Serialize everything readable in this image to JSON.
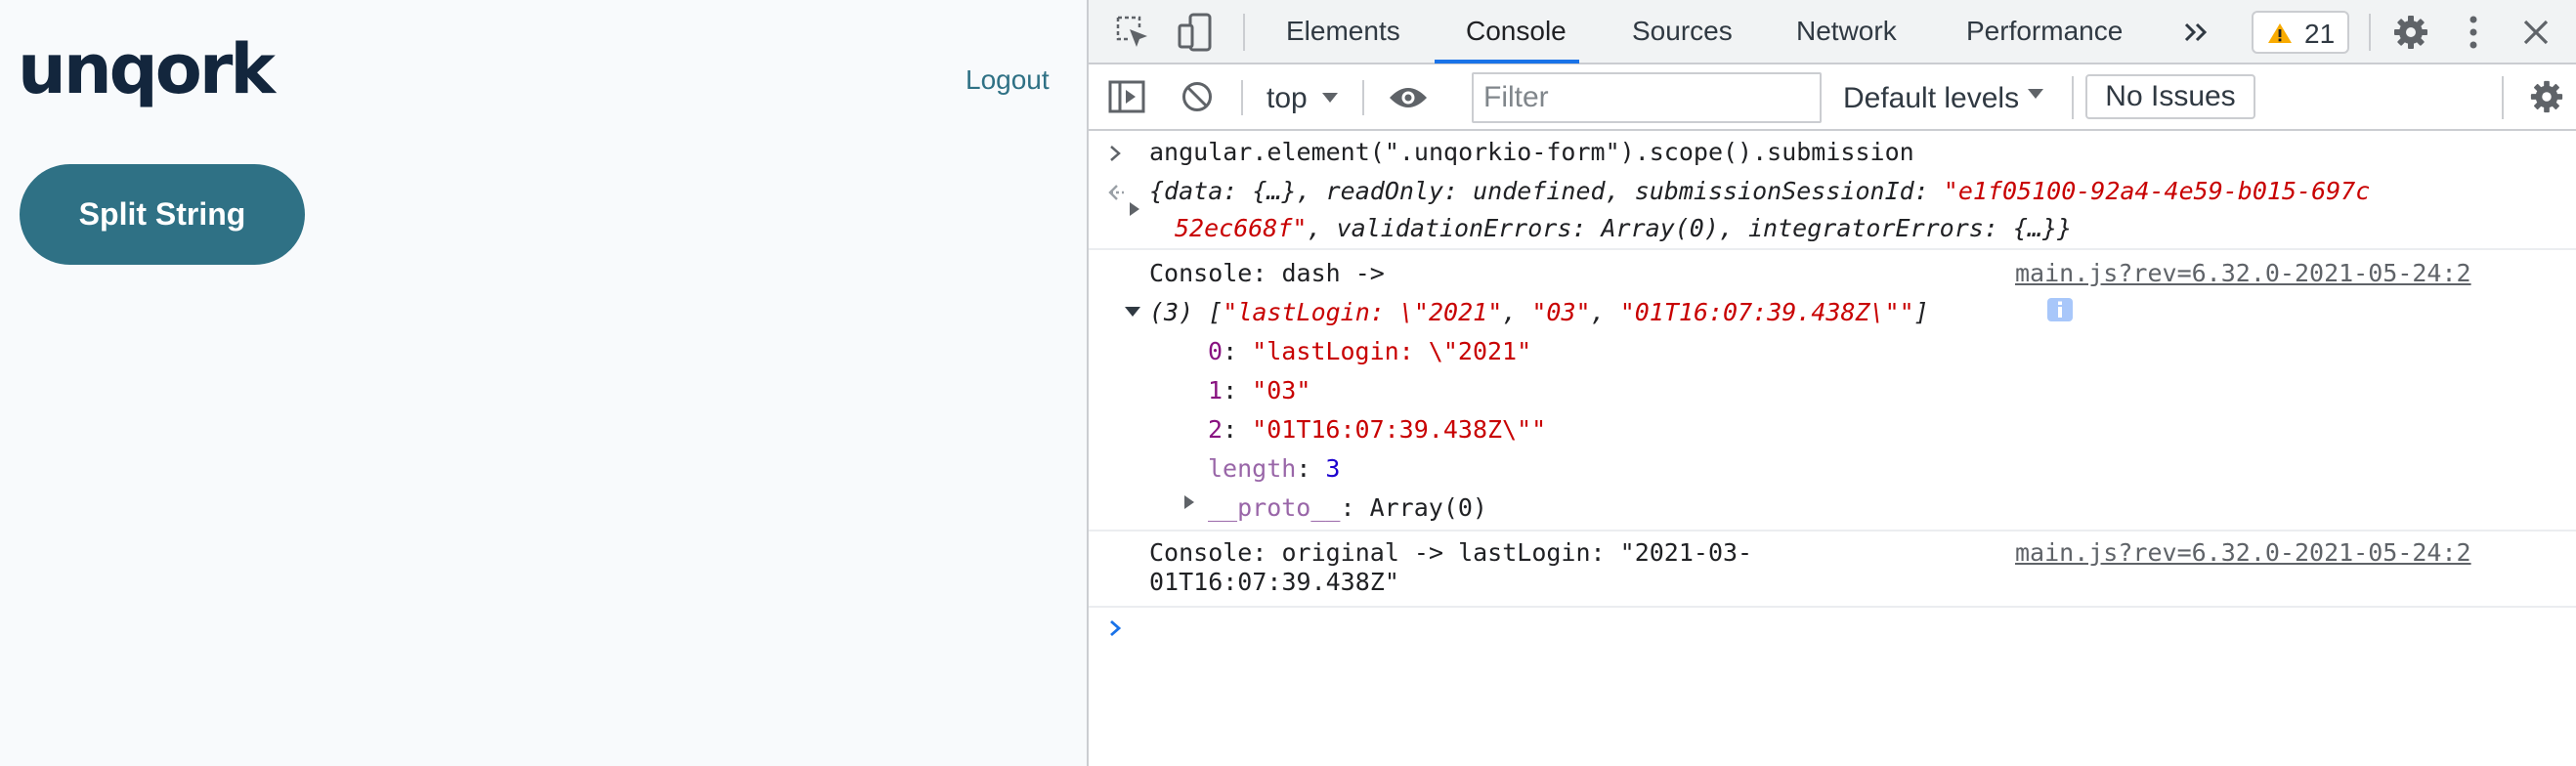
{
  "app": {
    "logo": "unqork",
    "logout_label": "Logout",
    "split_button_label": "Split String",
    "accent_color": "#2f7185"
  },
  "devtools": {
    "tabs": [
      "Elements",
      "Console",
      "Sources",
      "Network",
      "Performance"
    ],
    "active_tab": "Console",
    "more_tabs_icon": "double-chevron-right-icon",
    "warnings_count": "21",
    "toolbar": {
      "context": "top",
      "filter_placeholder": "Filter",
      "levels": "Default levels",
      "issues": "No Issues"
    },
    "console": {
      "cmd1": "angular.element(\".unqorkio-form\").scope().submission",
      "res1_a": "{data: {…}, readOnly: undefined, submissionSessionId: ",
      "res1_id_a": "\"e1f05100-92a4-4e59-b015-697c",
      "res1_id_b": "52ec668f\"",
      "res1_b": ", validationErrors: Array(0), integratorErrors: {…}}",
      "log1_label": "Console: dash ->",
      "log1_source": "main.js?rev=6.32.0-2021-05-24:2",
      "array_count": "(3) [",
      "array_items": [
        "\"lastLogin: \\\"2021\"",
        "\"03\"",
        "\"01T16:07:39.438Z\\\"\""
      ],
      "array_close": "]",
      "array_keys": [
        "0",
        "1",
        "2"
      ],
      "length_key": "length",
      "length_value": "3",
      "proto_key": "__proto__",
      "proto_value": ": Array(0)",
      "log2_line1": "Console: original -> lastLogin: \"2021-03-",
      "log2_line2": "01T16:07:39.438Z\"",
      "log2_source": "main.js?rev=6.32.0-2021-05-24:2"
    }
  }
}
